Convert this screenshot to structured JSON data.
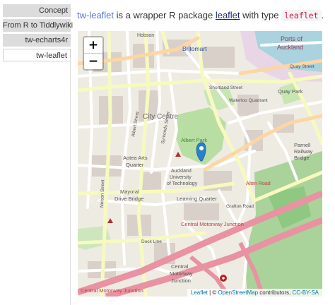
{
  "tabs": [
    {
      "label": "Concept"
    },
    {
      "label": "From R to Tiddlywiki"
    },
    {
      "label": "tw-echarts4r"
    },
    {
      "label": "tw-leaflet",
      "active": true
    }
  ],
  "intro": {
    "link_tw": "tw-leaflet",
    "text1": " is a wrapper R package ",
    "link_pkg": "leaflet",
    "text2": " with type ",
    "code": "leaflet",
    "text3": "."
  },
  "map": {
    "zoom_in": "+",
    "zoom_out": "−",
    "labels": {
      "britomart": "Britomart",
      "ports": "Ports of",
      "auckland": "Auckland",
      "quay": "Quay Street",
      "quay_park": "Quay Park",
      "city_centre": "City Centre",
      "albert_park": "Albert Park",
      "aotea1": "Aotea Arts",
      "aotea2": "Quarter",
      "uni1": "Auckland",
      "uni2": "University",
      "uni3": "of Technology",
      "mayoral1": "Mayoral",
      "mayoral2": "Drive Bridge",
      "learning": "Learning Quarter",
      "alten": "Alten Road",
      "motorway1": "Central Motorway Junction",
      "motorway2": "Central",
      "motorway3": "Motorway",
      "motorway4": "Junction",
      "motorway5": "Central Motorway Junction",
      "parnell1": "Parnell",
      "parnell2": "Railway",
      "parnell3": "Bridge",
      "hobson": "Hobson",
      "shortland": "Shortland Street",
      "albert_st": "Albert Street",
      "symonds": "Symonds Street",
      "nelson": "Nelson Street",
      "waterloo": "Waterloo Quadrant",
      "grafton": "Grafton Road",
      "dock": "Dock Line"
    },
    "attribution": {
      "leaflet": "Leaflet",
      "sep": " | © ",
      "osm": "OpenStreetMap",
      "contrib": " contributors, ",
      "license": "CC-BY-SA"
    }
  }
}
